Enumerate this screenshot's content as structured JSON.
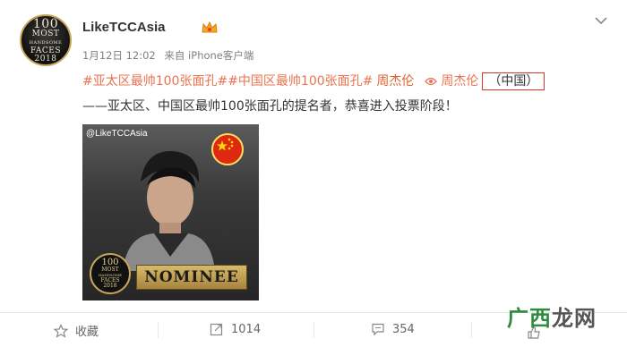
{
  "post": {
    "author": {
      "name": "LikeTCCAsia",
      "avatar_text": [
        "100",
        "MOST",
        "HANDSOME",
        "FACES",
        "2018"
      ]
    },
    "meta": {
      "time": "1月12日 12:02",
      "source": "来自 iPhone客户端"
    },
    "tags": {
      "tag1": "#亚太区最帅100张面孔#",
      "tag2": "#中国区最帅100张面孔#",
      "tag3": "周杰伦",
      "location": "周杰伦",
      "location_highlight": "（中国）"
    },
    "body": "——亚太区、中国区最帅100张面孔的提名者，恭喜进入投票阶段！",
    "image": {
      "watermark": "@LikeTCCAsia",
      "nominee_label": "NOMINEE",
      "seal_text": [
        "100",
        "MOST",
        "HANDSOME",
        "FACES",
        "2018"
      ]
    }
  },
  "actions": {
    "favorite": "收藏",
    "repost": "1014",
    "comment": "354"
  },
  "site_logo": {
    "part1": "广西",
    "part2": "龙网"
  },
  "colors": {
    "tag": "#eb7350",
    "highlight_border": "#d9342b",
    "logo_green": "#2e8b3d"
  }
}
